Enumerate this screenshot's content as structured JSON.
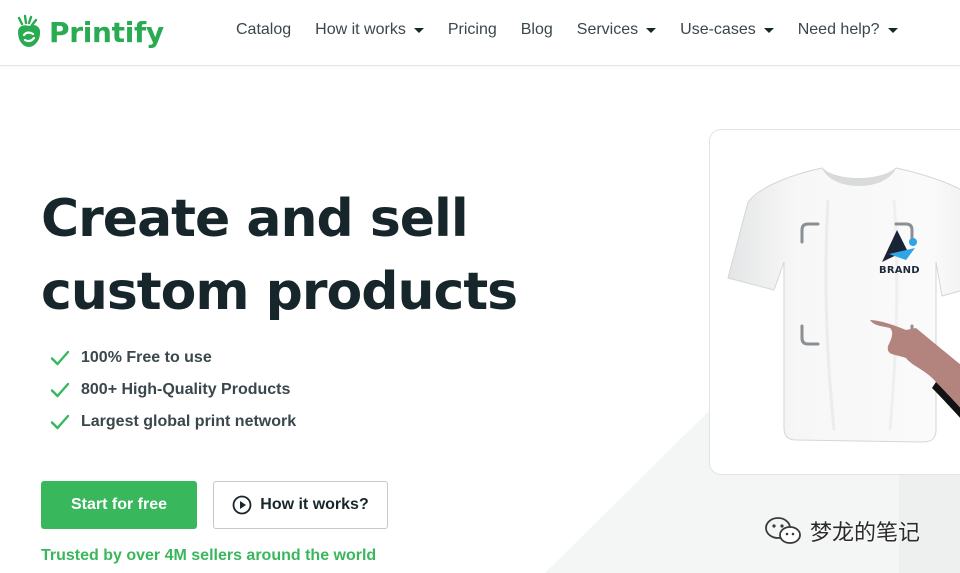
{
  "header": {
    "brand": "Printify",
    "nav": [
      {
        "label": "Catalog",
        "dropdown": false
      },
      {
        "label": "How it works",
        "dropdown": true
      },
      {
        "label": "Pricing",
        "dropdown": false
      },
      {
        "label": "Blog",
        "dropdown": false
      },
      {
        "label": "Services",
        "dropdown": true
      },
      {
        "label": "Use-cases",
        "dropdown": true
      },
      {
        "label": "Need help?",
        "dropdown": true
      }
    ]
  },
  "hero": {
    "headline_line1": "Create and sell",
    "headline_line2": "custom products",
    "features": [
      "100% Free to use",
      "800+ High-Quality Products",
      "Largest global print network"
    ],
    "primary_cta": "Start for free",
    "secondary_cta": "How it works?",
    "trusted": "Trusted by over 4M sellers around the world"
  },
  "product_card": {
    "brand_label": "BRAND",
    "icons": [
      "tshirt-mockup",
      "brand-logo",
      "pointing-hand"
    ]
  },
  "watermark": {
    "text": "梦龙的笔记",
    "icon": "wechat-icon"
  },
  "colors": {
    "brand_green": "#29ab51",
    "cta_green": "#39b75d",
    "headline": "#17262b",
    "body_text": "#3a474c"
  }
}
